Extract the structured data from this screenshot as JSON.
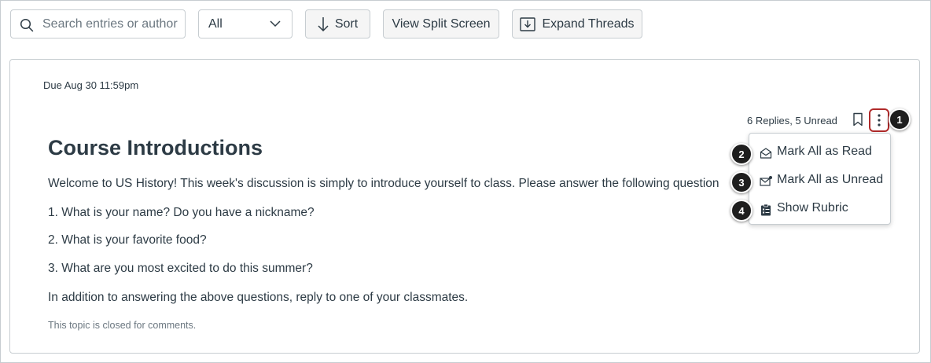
{
  "toolbar": {
    "search_placeholder": "Search entries or author",
    "filter_value": "All",
    "sort_label": "Sort",
    "split_label": "View Split Screen",
    "expand_label": "Expand Threads"
  },
  "topic": {
    "due": "Due Aug 30 11:59pm",
    "replies_summary": "6 Replies, 5 Unread",
    "title": "Course Introductions",
    "paragraphs": [
      "Welcome to US History! This week's discussion is simply to introduce yourself to class. Please answer the following question",
      "1. What is your name? Do you have a nickname?",
      "2. What is your favorite food?",
      "3. What are you most excited to do this summer?",
      "In addition to answering the above questions, reply to one of your classmates."
    ],
    "closed_note": "This topic is closed for comments."
  },
  "menu": {
    "items": [
      {
        "label": "Mark All as Read",
        "icon": "envelope-open-icon"
      },
      {
        "label": "Mark All as Unread",
        "icon": "envelope-unread-icon"
      },
      {
        "label": "Show Rubric",
        "icon": "rubric-icon"
      }
    ]
  },
  "callouts": [
    "1",
    "2",
    "3",
    "4"
  ],
  "colors": {
    "highlight_border": "#b02a2a",
    "text": "#2d3b45",
    "muted": "#6b7780"
  }
}
